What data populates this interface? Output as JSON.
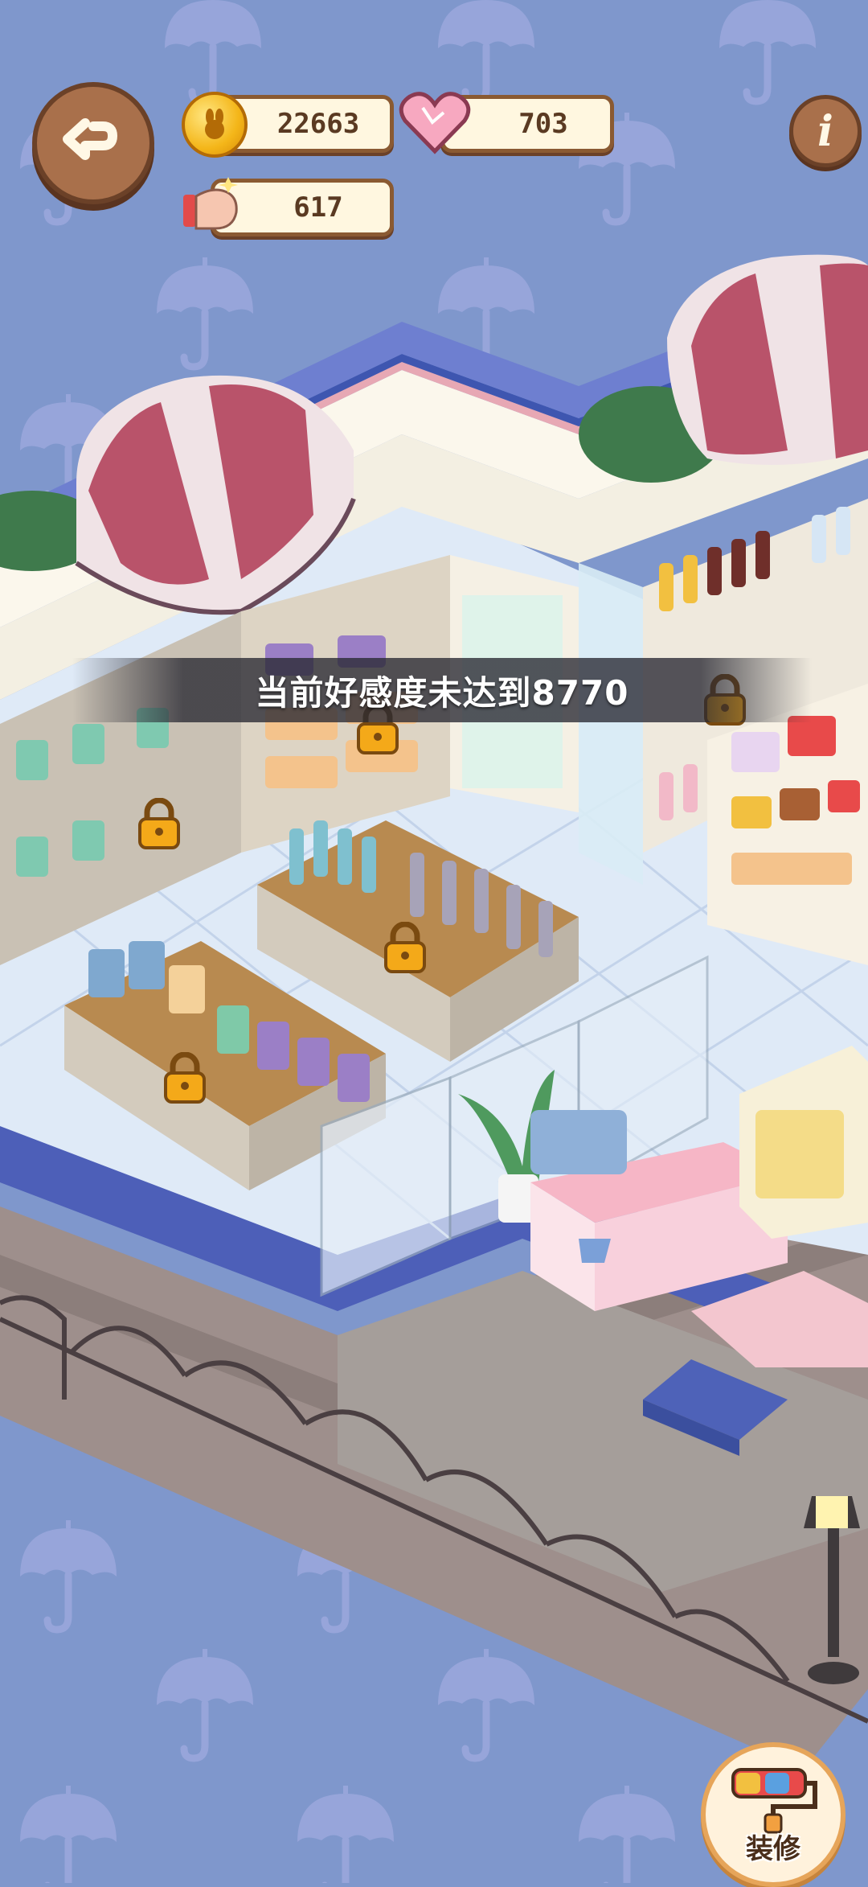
{
  "hud": {
    "coins": "22663",
    "hearts": "703",
    "energy": "617"
  },
  "tip": "当前好感度未达到8770",
  "decor_button": {
    "label": "装修"
  },
  "icons": [
    "back-arrow-icon",
    "info-icon",
    "coin-icon",
    "heart-icon",
    "hand-icon",
    "lock-icon",
    "paint-roller-icon"
  ],
  "colors": {
    "background": "#7f97cc",
    "accent_wood": "#a9704b",
    "awning_red": "#b9536a"
  }
}
